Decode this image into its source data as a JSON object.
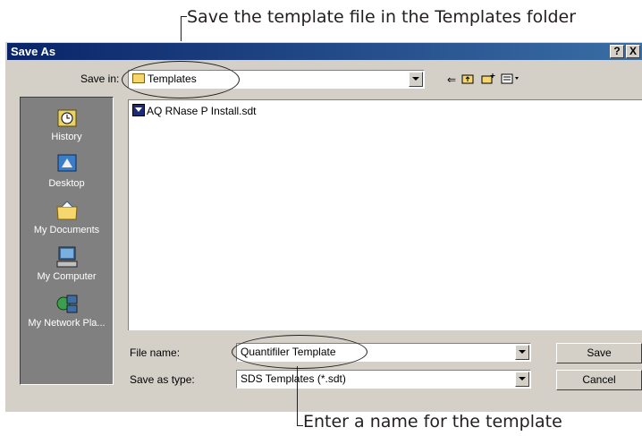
{
  "callouts": {
    "top": "Save the template file in the Templates folder",
    "bottom": "Enter a name for the template"
  },
  "dialog": {
    "title": "Save As",
    "help_btn": "?",
    "close_btn": "X",
    "save_in_label": "Save in:",
    "save_in_value": "Templates",
    "file_name_label": "File name:",
    "file_name_value": "Quantifiler Template",
    "save_as_type_label": "Save as type:",
    "save_as_type_value": "SDS Templates (*.sdt)",
    "save_button": "Save",
    "cancel_button": "Cancel"
  },
  "places": [
    {
      "label": "History",
      "icon": "history-icon"
    },
    {
      "label": "Desktop",
      "icon": "desktop-icon"
    },
    {
      "label": "My Documents",
      "icon": "my-documents-icon"
    },
    {
      "label": "My Computer",
      "icon": "my-computer-icon"
    },
    {
      "label": "My Network Pla...",
      "icon": "my-network-places-icon"
    }
  ],
  "files": [
    {
      "name": "AQ RNase P Install.sdt"
    }
  ],
  "toolbar_icons": [
    "back-icon",
    "up-folder-icon",
    "new-folder-icon",
    "views-menu-icon"
  ],
  "colors": {
    "titlebar_start": "#0a246a",
    "titlebar_end": "#3a6ea5",
    "dialog_face": "#d4d0c8",
    "places_bar": "#808080"
  }
}
